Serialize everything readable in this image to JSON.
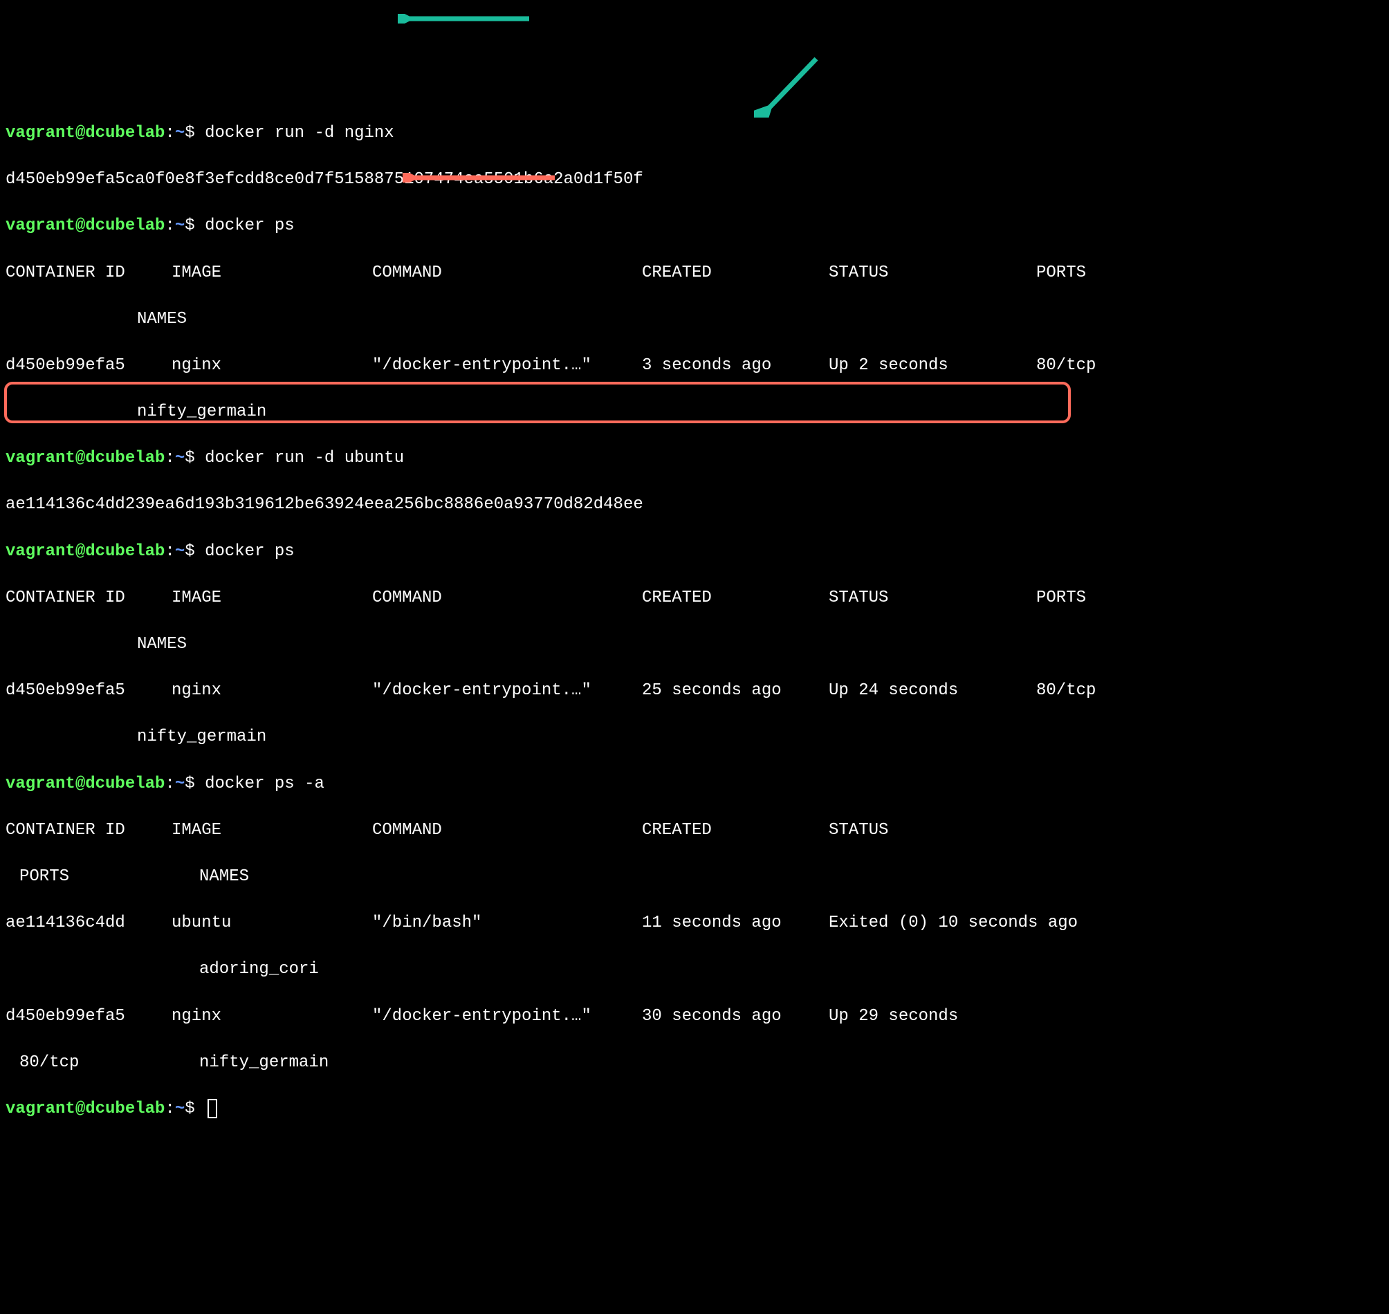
{
  "prompt": {
    "user": "vagrant@dcubelab",
    "colon": ":",
    "path": "~",
    "dollar": "$"
  },
  "commands": {
    "cmd1": "docker run -d nginx",
    "cmd2": "docker ps",
    "cmd3": "docker run -d ubuntu",
    "cmd4": "docker ps",
    "cmd5": "docker ps -a"
  },
  "outputs": {
    "hash1": "d450eb99efa5ca0f0e8f3efcdd8ce0d7f5158875107474ea5501b6a2a0d1f50f",
    "hash2": "ae114136c4dd239ea6d193b319612be63924eea256bc8886e0a93770d82d48ee"
  },
  "headers": {
    "container_id": "CONTAINER ID",
    "image": "IMAGE",
    "command": "COMMAND",
    "created": "CREATED",
    "status": "STATUS",
    "ports": "PORTS",
    "names": "NAMES"
  },
  "ps1": {
    "row1": {
      "id": "d450eb99efa5",
      "image": "nginx",
      "command": "\"/docker-entrypoint.…\"",
      "created": "3 seconds ago",
      "status": "Up 2 seconds",
      "ports": "80/tcp",
      "names": "nifty_germain"
    }
  },
  "ps2": {
    "row1": {
      "id": "d450eb99efa5",
      "image": "nginx",
      "command": "\"/docker-entrypoint.…\"",
      "created": "25 seconds ago",
      "status": "Up 24 seconds",
      "ports": "80/tcp",
      "names": "nifty_germain"
    }
  },
  "ps3": {
    "row1": {
      "id": "ae114136c4dd",
      "image": "ubuntu",
      "command": "\"/bin/bash\"",
      "created": "11 seconds ago",
      "status": "Exited (0) 10 seconds ago",
      "names": "adoring_cori"
    },
    "row2": {
      "id": "d450eb99efa5",
      "image": "nginx",
      "command": "\"/docker-entrypoint.…\"",
      "created": "30 seconds ago",
      "status": "Up 29 seconds",
      "ports": "80/tcp",
      "names": "nifty_germain"
    }
  }
}
